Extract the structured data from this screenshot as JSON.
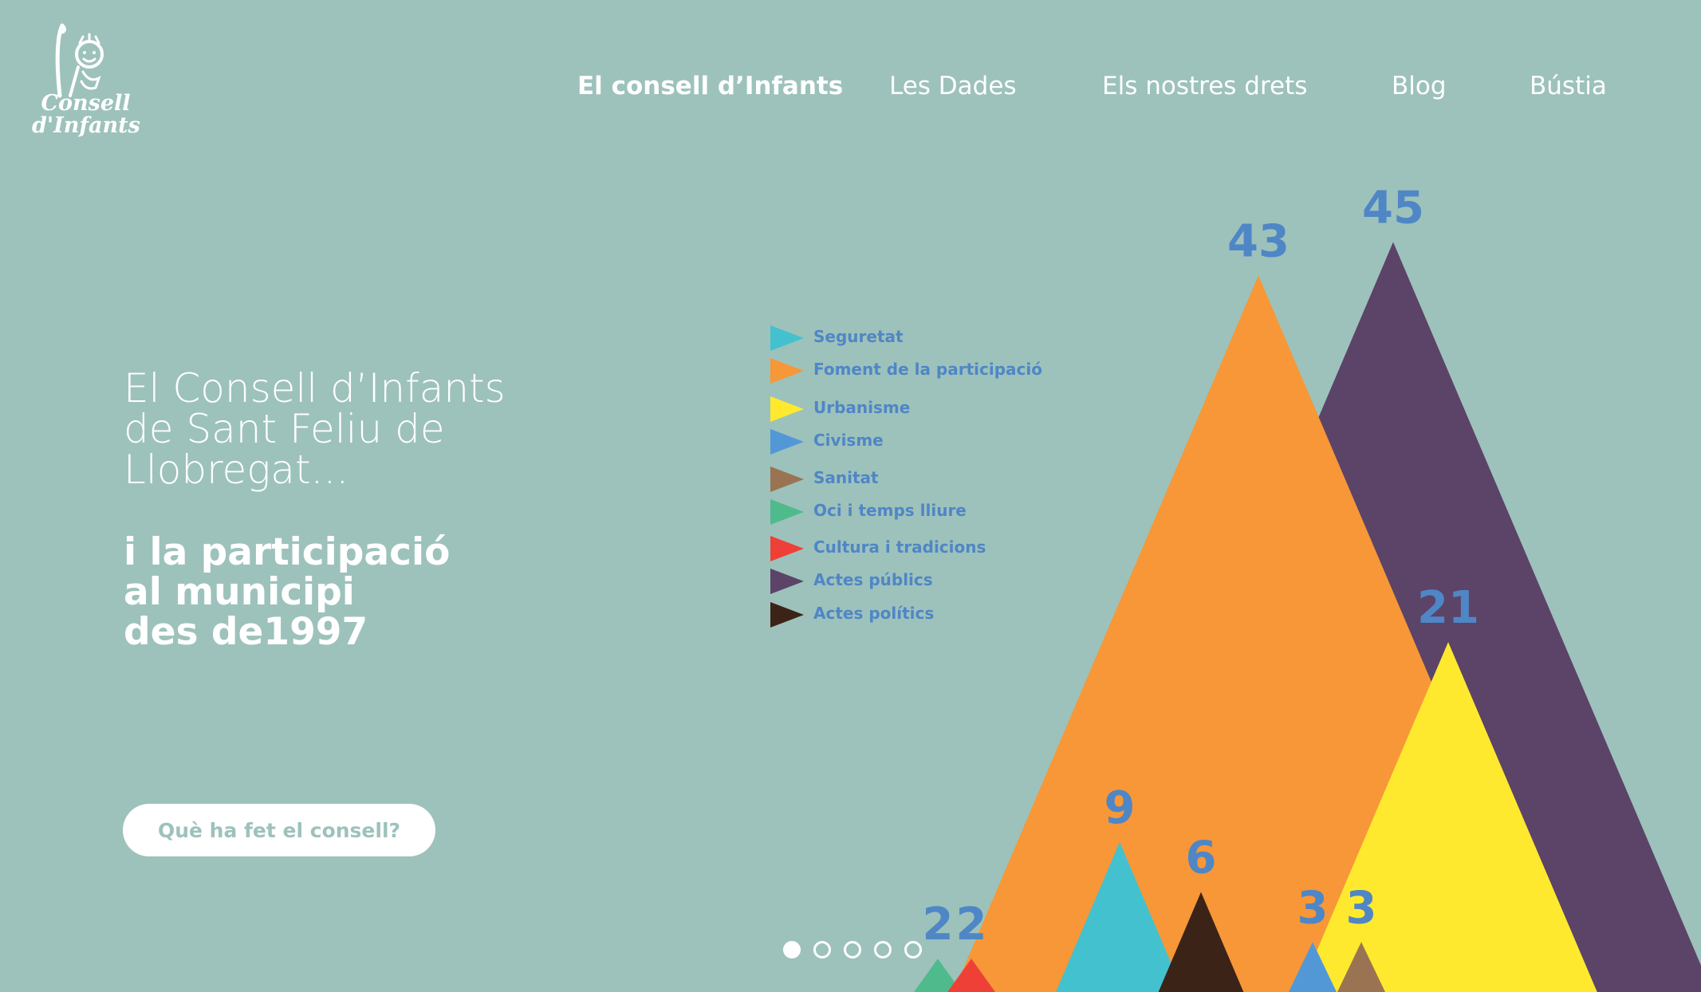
{
  "logo": {
    "line1": "Consell",
    "line2": "d'Infants"
  },
  "nav": [
    {
      "label": "El consell d’Infants",
      "active": true
    },
    {
      "label": "Les Dades",
      "active": false
    },
    {
      "label": "Els nostres drets",
      "active": false
    },
    {
      "label": "Blog",
      "active": false
    },
    {
      "label": "Bústia",
      "active": false
    }
  ],
  "hero": {
    "line1": "El Consell d’Infants",
    "line2": "de Sant Feliu de",
    "line3": "Llobregat...",
    "bold1": "i la participació",
    "bold2": "al municipi",
    "bold3": "des de1997"
  },
  "cta": {
    "label": "Què ha fet el consell?"
  },
  "legend": [
    {
      "label": "Seguretat",
      "color": "#43c1cf"
    },
    {
      "label": "Foment de la participació",
      "color": "#f79737"
    },
    {
      "label": "Urbanisme",
      "color": "#ffe92f"
    },
    {
      "label": "Civisme",
      "color": "#5398d6"
    },
    {
      "label": "Sanitat",
      "color": "#9a7452"
    },
    {
      "label": "Oci i temps lliure",
      "color": "#4fbb8d"
    },
    {
      "label": "Cultura i tradicions",
      "color": "#ef4038"
    },
    {
      "label": "Actes públics",
      "color": "#5c4368"
    },
    {
      "label": "Actes polítics",
      "color": "#3b2318"
    }
  ],
  "pager": {
    "count": 5,
    "active": 0
  },
  "chart_data": {
    "type": "bar",
    "categories": [
      "Oci i temps lliure",
      "Cultura i tradicions",
      "Foment de la participació",
      "Actes públics",
      "Seguretat",
      "Actes polítics",
      "Civisme",
      "Sanitat",
      "Urbanisme"
    ],
    "values": [
      2,
      2,
      43,
      45,
      9,
      6,
      3,
      3,
      21
    ],
    "colors": [
      "#4fbb8d",
      "#ef4038",
      "#f79737",
      "#5c4368",
      "#43c1cf",
      "#3b2318",
      "#5398d6",
      "#9a7452",
      "#ffe92f"
    ],
    "labels": [
      "2",
      "2",
      "43",
      "45",
      "9",
      "6",
      "3",
      "3",
      "21"
    ],
    "ylim": [
      0,
      45
    ]
  }
}
